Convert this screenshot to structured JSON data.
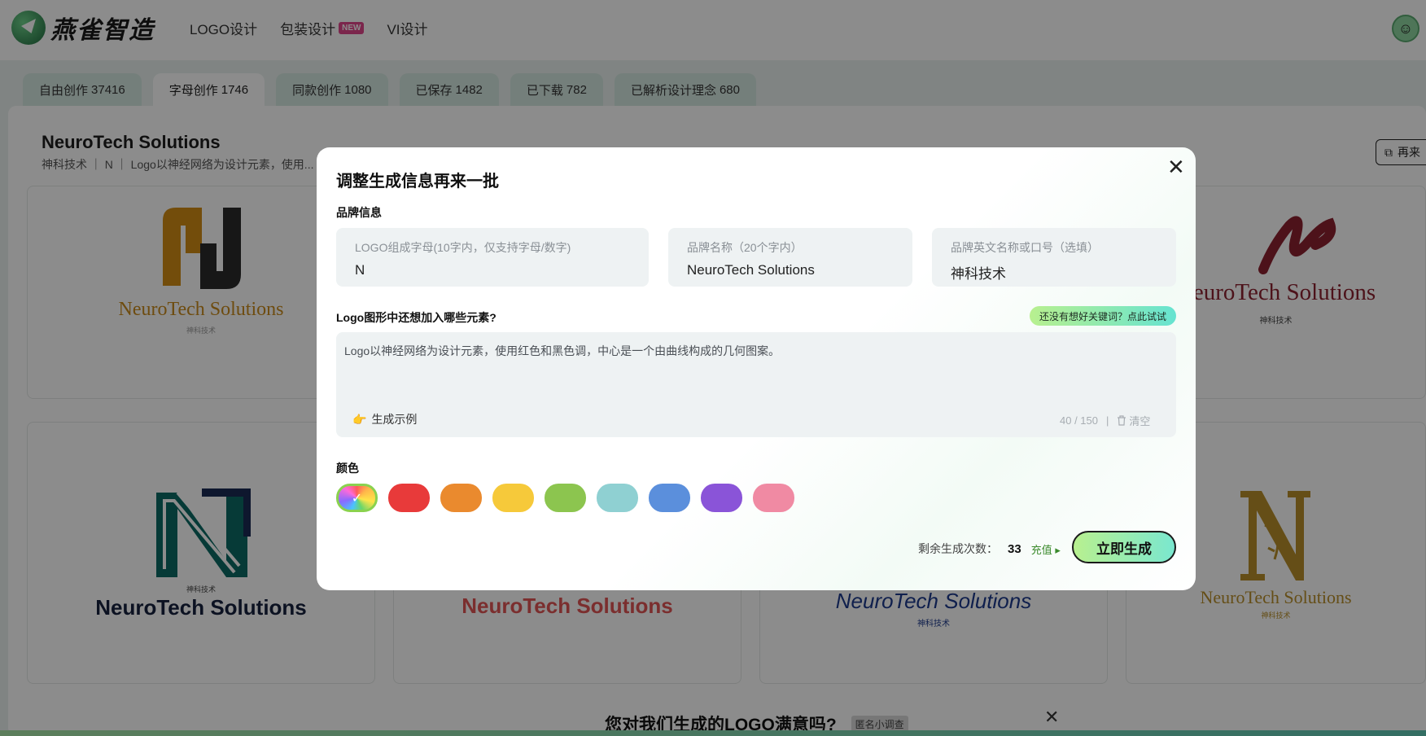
{
  "header": {
    "logo_text": "燕雀智造",
    "nav": [
      {
        "label": "LOGO设计"
      },
      {
        "label": "包装设计",
        "badge": "NEW"
      },
      {
        "label": "VI设计"
      }
    ],
    "avatar_count": "1"
  },
  "tabs": [
    {
      "label": "自由创作",
      "count": "37416"
    },
    {
      "label": "字母创作",
      "count": "1746"
    },
    {
      "label": "同款创作",
      "count": "1080"
    },
    {
      "label": "已保存",
      "count": "1482"
    },
    {
      "label": "已下载",
      "count": "782"
    },
    {
      "label": "已解析设计理念",
      "count": "680"
    }
  ],
  "project": {
    "title": "NeuroTech Solutions",
    "subtitle": "神科技术 ｜ N ｜ Logo以神经网络为设计元素，使用...",
    "again_label": "再来"
  },
  "cards": {
    "brand_en": "NeuroTech Solutions",
    "brand_cn": "神科技术"
  },
  "survey": {
    "question": "您对我们生成的LOGO满意吗?",
    "tag": "匿名小调查"
  },
  "modal": {
    "title": "调整生成信息再来一批",
    "brand_section": "品牌信息",
    "fields": {
      "letters": {
        "placeholder": "LOGO组成字母(10字内，仅支持字母/数字)",
        "value": "N"
      },
      "name": {
        "placeholder": "品牌名称（20个字内）",
        "value": "NeuroTech Solutions"
      },
      "slogan": {
        "placeholder": "品牌英文名称或口号（选填）",
        "value": "神科技术"
      }
    },
    "elements_section": "Logo图形中还想加入哪些元素?",
    "keyword_button": "还没有想好关键词？点此试试",
    "description": "Logo以神经网络为设计元素，使用红色和黑色调，中心是一个由曲线构成的几何图案。",
    "example_button": "生成示例",
    "counter": "40 / 150",
    "clear_label": "清空",
    "color_section": "颜色",
    "colors": [
      "rainbow",
      "#e83a3a",
      "#ea8a2e",
      "#f6c93a",
      "#8cc54f",
      "#8fd0d2",
      "#5b8fdc",
      "#8a54d8",
      "#f08aa3"
    ],
    "remain_label": "剩余生成次数：",
    "remain_count": "33",
    "recharge_label": "充值",
    "generate_button": "立即生成"
  }
}
